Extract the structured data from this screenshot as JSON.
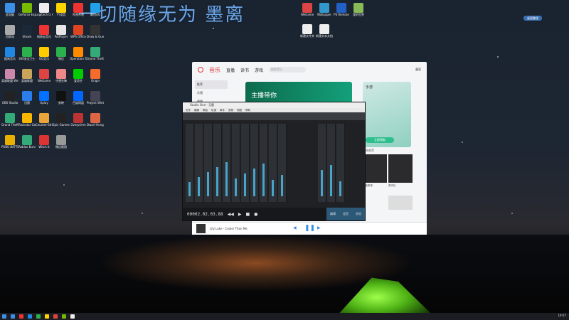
{
  "watermark": "一切随缘无为 墨离",
  "desktop_icons": [
    {
      "label": "此电脑",
      "color": "#3b8fe6"
    },
    {
      "label": "GeForce Experience",
      "color": "#76b900"
    },
    {
      "label": "Logitech G HUB",
      "color": "#eee"
    },
    {
      "label": "YY语音",
      "color": "#ffd400"
    },
    {
      "label": "哔哩哔哩",
      "color": "#e33"
    },
    {
      "label": "腾讯QQ",
      "color": "#22a0e8"
    },
    {
      "label": "回收站",
      "color": "#aaa"
    },
    {
      "label": "Steam",
      "color": "#1b2838"
    },
    {
      "label": "网易云音乐",
      "color": "#e33"
    },
    {
      "label": "PotPlayer",
      "color": "#e6e6e6"
    },
    {
      "label": "WPS Office",
      "color": "#d42"
    },
    {
      "label": "Draw & Guess",
      "color": "#333"
    },
    {
      "label": "酷狗音乐",
      "color": "#1f88e5"
    },
    {
      "label": "360安全卫士",
      "color": "#2bb24c"
    },
    {
      "label": "QQ音乐",
      "color": "#fc0"
    },
    {
      "label": "微信",
      "color": "#2bb24c"
    },
    {
      "label": "Operation Tango",
      "color": "#ff8a00"
    },
    {
      "label": "Grand Theft Auto V",
      "color": "#3a7"
    },
    {
      "label": "英雄联盟 WeGame",
      "color": "#c8a"
    },
    {
      "label": "英雄联盟",
      "color": "#c9a55b"
    },
    {
      "label": "WeGame",
      "color": "#d44"
    },
    {
      "label": "守望先锋",
      "color": "#e88"
    },
    {
      "label": "爱奇艺",
      "color": "#0c0"
    },
    {
      "label": "Origin",
      "color": "#f56c2d"
    },
    {
      "label": "OBS Studio",
      "color": "#222"
    },
    {
      "label": "迅雷",
      "color": "#2b7de9"
    },
    {
      "label": "Uplay",
      "color": "#0070ff"
    },
    {
      "label": "剪映",
      "color": "#111"
    },
    {
      "label": "百度网盘",
      "color": "#06f"
    },
    {
      "label": "Project Winter",
      "color": "#445"
    },
    {
      "label": "Grand Theft Auto V",
      "color": "#3a7"
    },
    {
      "label": "Rockstar Games",
      "color": "#f9b700"
    },
    {
      "label": "Counter-Strike",
      "color": "#e9a53a"
    },
    {
      "label": "Epic Games Launcher",
      "color": "#222"
    },
    {
      "label": "Overprime",
      "color": "#b33"
    },
    {
      "label": "Dwarf Hunger",
      "color": "#d64"
    },
    {
      "label": "PUBG BATTLEGROUNDS",
      "color": "#e9b000"
    },
    {
      "label": "Roblox Bundle",
      "color": "#3a7"
    },
    {
      "label": "Witch It",
      "color": "#d33"
    },
    {
      "label": "微信截图",
      "color": "#999"
    }
  ],
  "right_icons": [
    {
      "label": "WeGame",
      "color": "#d44"
    },
    {
      "label": "Wallpaper",
      "color": "#39c"
    },
    {
      "label": "PS Remote",
      "color": "#2160c4"
    },
    {
      "label": "我的世界",
      "color": "#8b5"
    },
    {
      "label": "新建文件夹",
      "color": "#eee"
    },
    {
      "label": "新建文本文档",
      "color": "#eee"
    }
  ],
  "topright_badge": "桌面整理",
  "music": {
    "tabs": [
      "音乐",
      "直播",
      "读书",
      "游戏"
    ],
    "active_tab": "音乐",
    "search_placeholder": "搜索音乐",
    "user": "墨离",
    "sidebar": [
      "推荐",
      "乐馆",
      "视频",
      "电台",
      "我的"
    ],
    "banner_title": "主播带你",
    "promo_title": "手游",
    "promo_button": "立即领取",
    "tiles_header": "更多推荐",
    "tiles": [
      "精选歌单",
      "周杰伦",
      "华语经典",
      "流行热歌"
    ],
    "now_playing": "Lily Luke - Cooler Than Me"
  },
  "daw": {
    "title": "Studio One - 无题",
    "menu": [
      "文件",
      "编辑",
      "歌曲",
      "轨道",
      "事件",
      "音频",
      "视图",
      "帮助"
    ],
    "time": "00002.02.03.88",
    "bottom_tabs": [
      "编辑",
      "混音",
      "浏览"
    ],
    "channels": 14
  },
  "taskbar": {
    "time": "19:07",
    "icon_colors": [
      "#3b8fe6",
      "#e33",
      "#1f88e5",
      "#2bb24c",
      "#ffd400",
      "#d44",
      "#76b900",
      "#eee"
    ]
  }
}
